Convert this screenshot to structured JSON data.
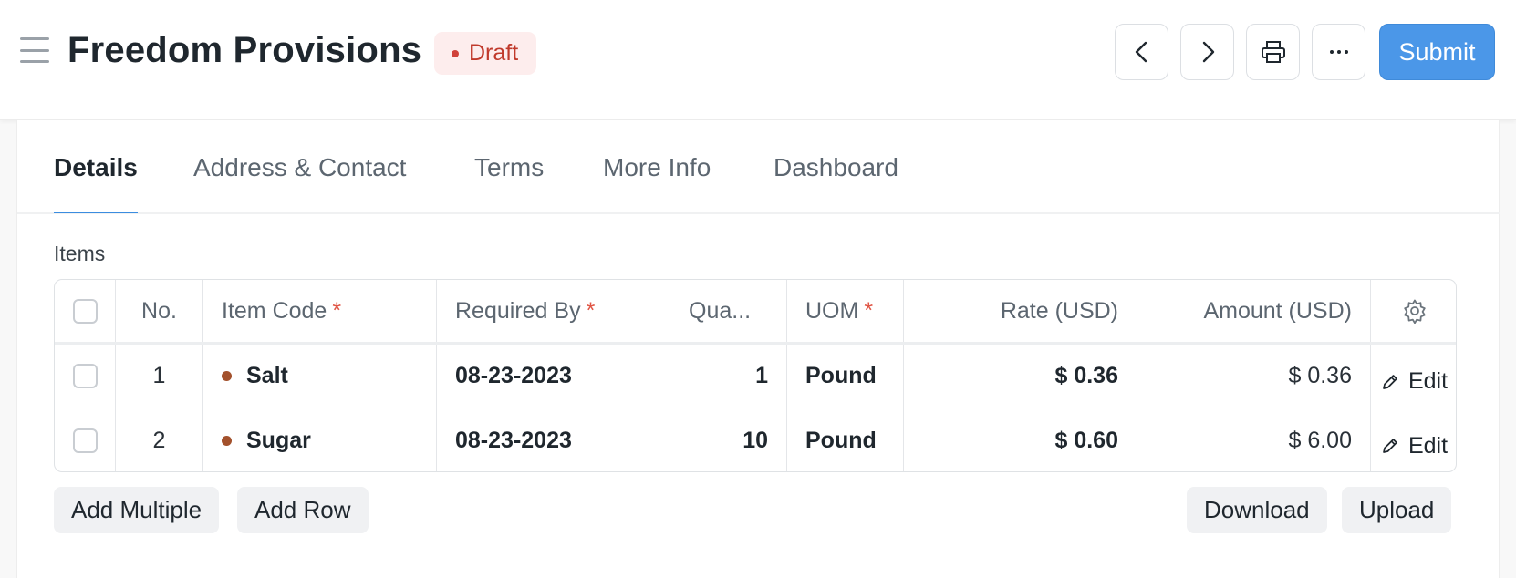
{
  "header": {
    "title": "Freedom Provisions",
    "status": "Draft",
    "submit_label": "Submit",
    "icons": [
      "menu-icon",
      "chevron-left-icon",
      "chevron-right-icon",
      "printer-icon",
      "more-horizontal-icon"
    ]
  },
  "tabs": [
    {
      "label": "Details",
      "active": true
    },
    {
      "label": "Address & Contact",
      "active": false
    },
    {
      "label": "Terms",
      "active": false
    },
    {
      "label": "More Info",
      "active": false
    },
    {
      "label": "Dashboard",
      "active": false
    }
  ],
  "items_section": {
    "label": "Items",
    "columns": [
      "No.",
      "Item Code",
      "Required By",
      "Qua...",
      "UOM",
      "Rate (USD)",
      "Amount (USD)"
    ],
    "required_marker": "*",
    "rows": [
      {
        "no": "1",
        "item_code": "Salt",
        "required_by": "08-23-2023",
        "qty": "1",
        "uom": "Pound",
        "rate": "$ 0.36",
        "amount": "$ 0.36",
        "edit": "Edit"
      },
      {
        "no": "2",
        "item_code": "Sugar",
        "required_by": "08-23-2023",
        "qty": "10",
        "uom": "Pound",
        "rate": "$ 0.60",
        "amount": "$ 6.00",
        "edit": "Edit"
      }
    ],
    "buttons": {
      "add_multiple": "Add Multiple",
      "add_row": "Add Row",
      "download": "Download",
      "upload": "Upload"
    }
  },
  "colors": {
    "accent": "#4b97e8",
    "draft_text": "#c0392b",
    "draft_bg": "#fdeded",
    "item_dot": "#a3512c",
    "required": "#e05545"
  }
}
